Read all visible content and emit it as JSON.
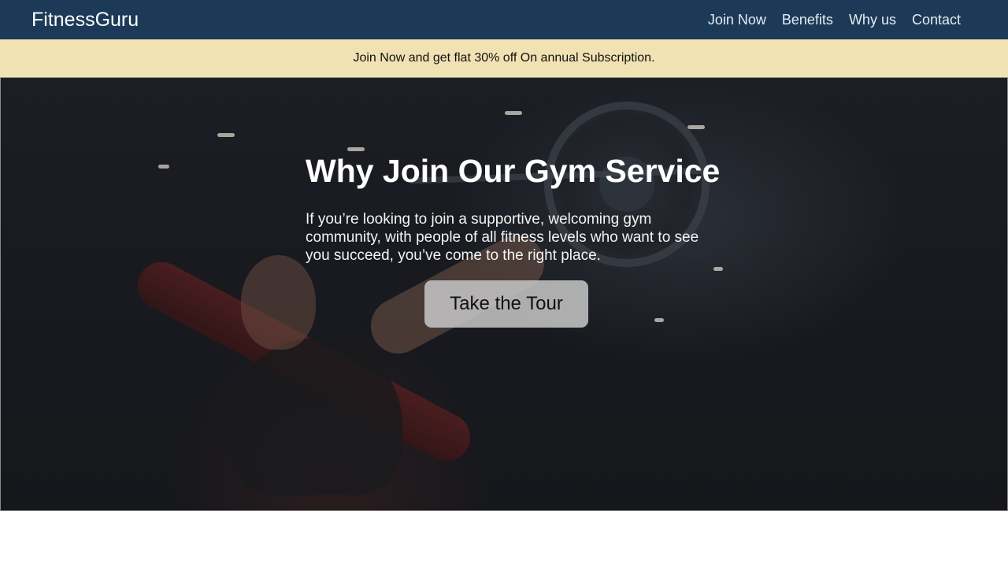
{
  "header": {
    "brand": "FitnessGuru",
    "nav": [
      {
        "label": "Join Now"
      },
      {
        "label": "Benefits"
      },
      {
        "label": "Why us"
      },
      {
        "label": "Contact"
      }
    ]
  },
  "promo": {
    "text": "Join Now and get flat 30% off On annual Subscription."
  },
  "hero": {
    "title": "Why Join Our Gym Service",
    "text": "If you’re looking to join a supportive, welcoming gym community, with people of all fitness levels who want to see you succeed, you’ve come to the right place.",
    "button_label": "Take the Tour"
  },
  "colors": {
    "navbar": "#1c3a58",
    "promo_bar": "#f0e2b2",
    "hero_overlay": "#17191e",
    "button": "#c8c8c8"
  }
}
